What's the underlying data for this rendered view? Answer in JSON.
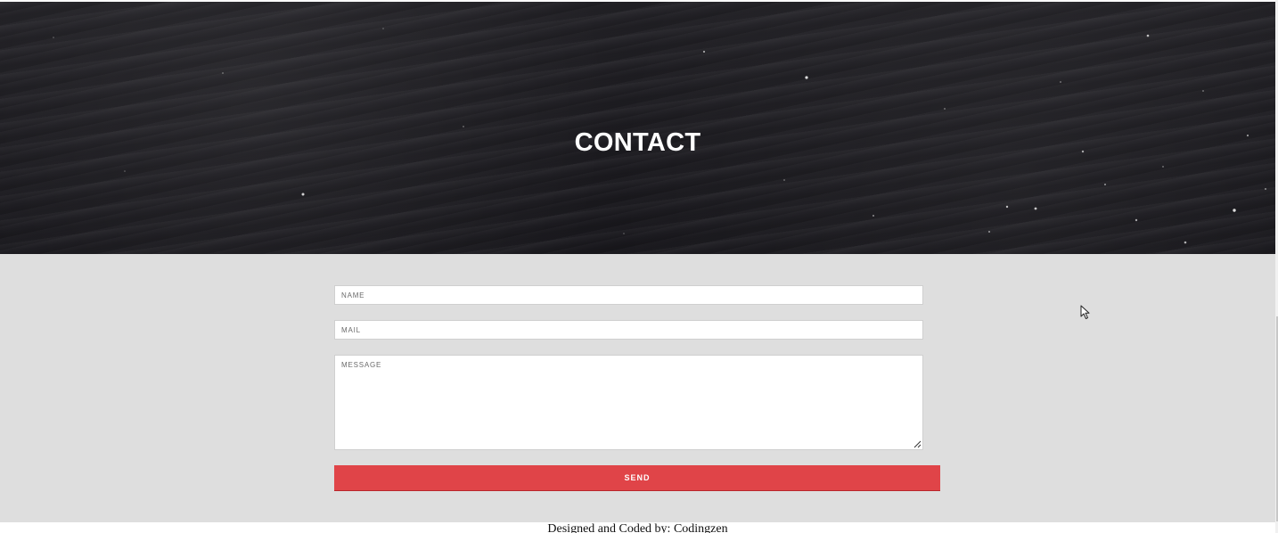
{
  "hero": {
    "title": "CONTACT"
  },
  "form": {
    "name_placeholder": "NAME",
    "mail_placeholder": "MAIL",
    "message_placeholder": "MESSAGE",
    "send_label": "SEND"
  },
  "footer": {
    "credit": "Designed and Coded by: Codingzen"
  },
  "colors": {
    "hero_background": "#1d1c21",
    "section_background": "#dedede",
    "button_accent": "#e04448"
  }
}
